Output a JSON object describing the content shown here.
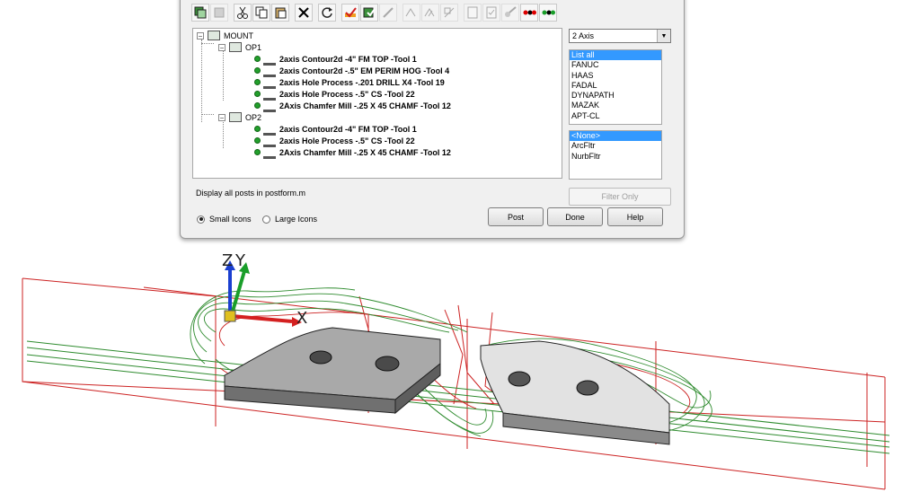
{
  "toolbar": {
    "buttons": [
      "select-all-icon",
      "deselect-icon",
      "cut-icon",
      "copy-icon",
      "paste-icon",
      "delete-icon",
      "regenerate-icon",
      "verify-icon",
      "post-process-icon",
      "simulate-icon",
      "tool-lib-icon",
      "tool-list-icon",
      "tool-edit-icon",
      "document-icon",
      "settings-icon",
      "sim-wand-icon",
      "dot-red-icon",
      "dot-green-icon"
    ]
  },
  "tree": {
    "root_label": "MOUNT",
    "ops": [
      {
        "label": "OP1",
        "items": [
          "2axis Contour2d  -4\" FM TOP -Tool 1",
          "2axis Contour2d  -.5\" EM PERIM HOG -Tool 4",
          "2axis Hole Process  -.201 DRILL X4  -Tool 19",
          "2axis Hole Process  -.5\" CS -Tool 22",
          "2Axis Chamfer Mill  -.25 X 45 CHAMF -Tool 12"
        ]
      },
      {
        "label": "OP2",
        "items": [
          "2axis Contour2d  -4\" FM TOP -Tool 1",
          "2axis Hole Process  -.5\" CS -Tool 22",
          "2Axis Chamfer Mill  -.25 X 45 CHAMF -Tool 12"
        ]
      }
    ]
  },
  "post_select": {
    "value": "2 Axis"
  },
  "post_list": {
    "items": [
      "List all",
      "FANUC",
      "HAAS",
      "FADAL",
      "DYNAPATH",
      "MAZAK",
      "APT-CL"
    ],
    "selected_index": 0
  },
  "filter_list": {
    "items": [
      "<None>",
      "ArcFltr",
      "NurbFltr"
    ],
    "selected_index": 0
  },
  "status_text": "Display all posts in postform.m",
  "filter_button": "Filter Only",
  "icon_size": {
    "small_label": "Small Icons",
    "large_label": "Large Icons",
    "selected": "small"
  },
  "buttons": {
    "post": "Post",
    "done": "Done",
    "help": "Help"
  },
  "axes": {
    "z": "Z",
    "y": "Y",
    "x": "X"
  },
  "colors": {
    "toolpath_red": "#cc2222",
    "toolpath_green": "#2e8b2e",
    "selection_blue": "#3399ff",
    "part_gray": "#a8a8a8"
  }
}
